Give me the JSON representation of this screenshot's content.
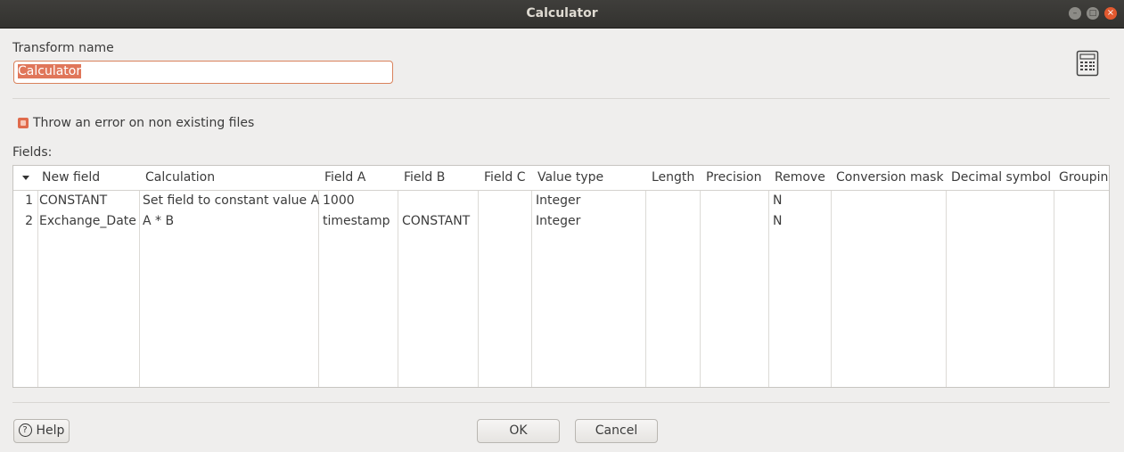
{
  "window": {
    "title": "Calculator"
  },
  "form": {
    "transform_name_label": "Transform name",
    "transform_name_value": "Calculator",
    "throw_error_label": "Throw an error on non existing files",
    "fields_label": "Fields:"
  },
  "table": {
    "headers": [
      "New field",
      "Calculation",
      "Field A",
      "Field B",
      "Field C",
      "Value type",
      "Length",
      "Precision",
      "Remove",
      "Conversion mask",
      "Decimal symbol",
      "Grouping"
    ],
    "rows": [
      {
        "num": "1",
        "new_field": "CONSTANT",
        "calculation": "Set field to constant value A",
        "field_a": "1000",
        "field_b": "",
        "field_c": "",
        "value_type": "Integer",
        "length": "",
        "precision": "",
        "remove": "N",
        "conversion_mask": "",
        "decimal_symbol": "",
        "grouping": ""
      },
      {
        "num": "2",
        "new_field": "Exchange_Date",
        "calculation": "A * B",
        "field_a": "timestamp",
        "field_b": "CONSTANT",
        "field_c": "",
        "value_type": "Integer",
        "length": "",
        "precision": "",
        "remove": "N",
        "conversion_mask": "",
        "decimal_symbol": "",
        "grouping": ""
      }
    ]
  },
  "buttons": {
    "help": "Help",
    "ok": "OK",
    "cancel": "Cancel"
  },
  "colors": {
    "titlebar": "#3f3e3b",
    "accent": "#e06b4c",
    "close": "#e2592f"
  },
  "icons": {
    "calculator": "calculator-icon",
    "help": "help-icon",
    "sort": "sort-arrow-icon"
  }
}
